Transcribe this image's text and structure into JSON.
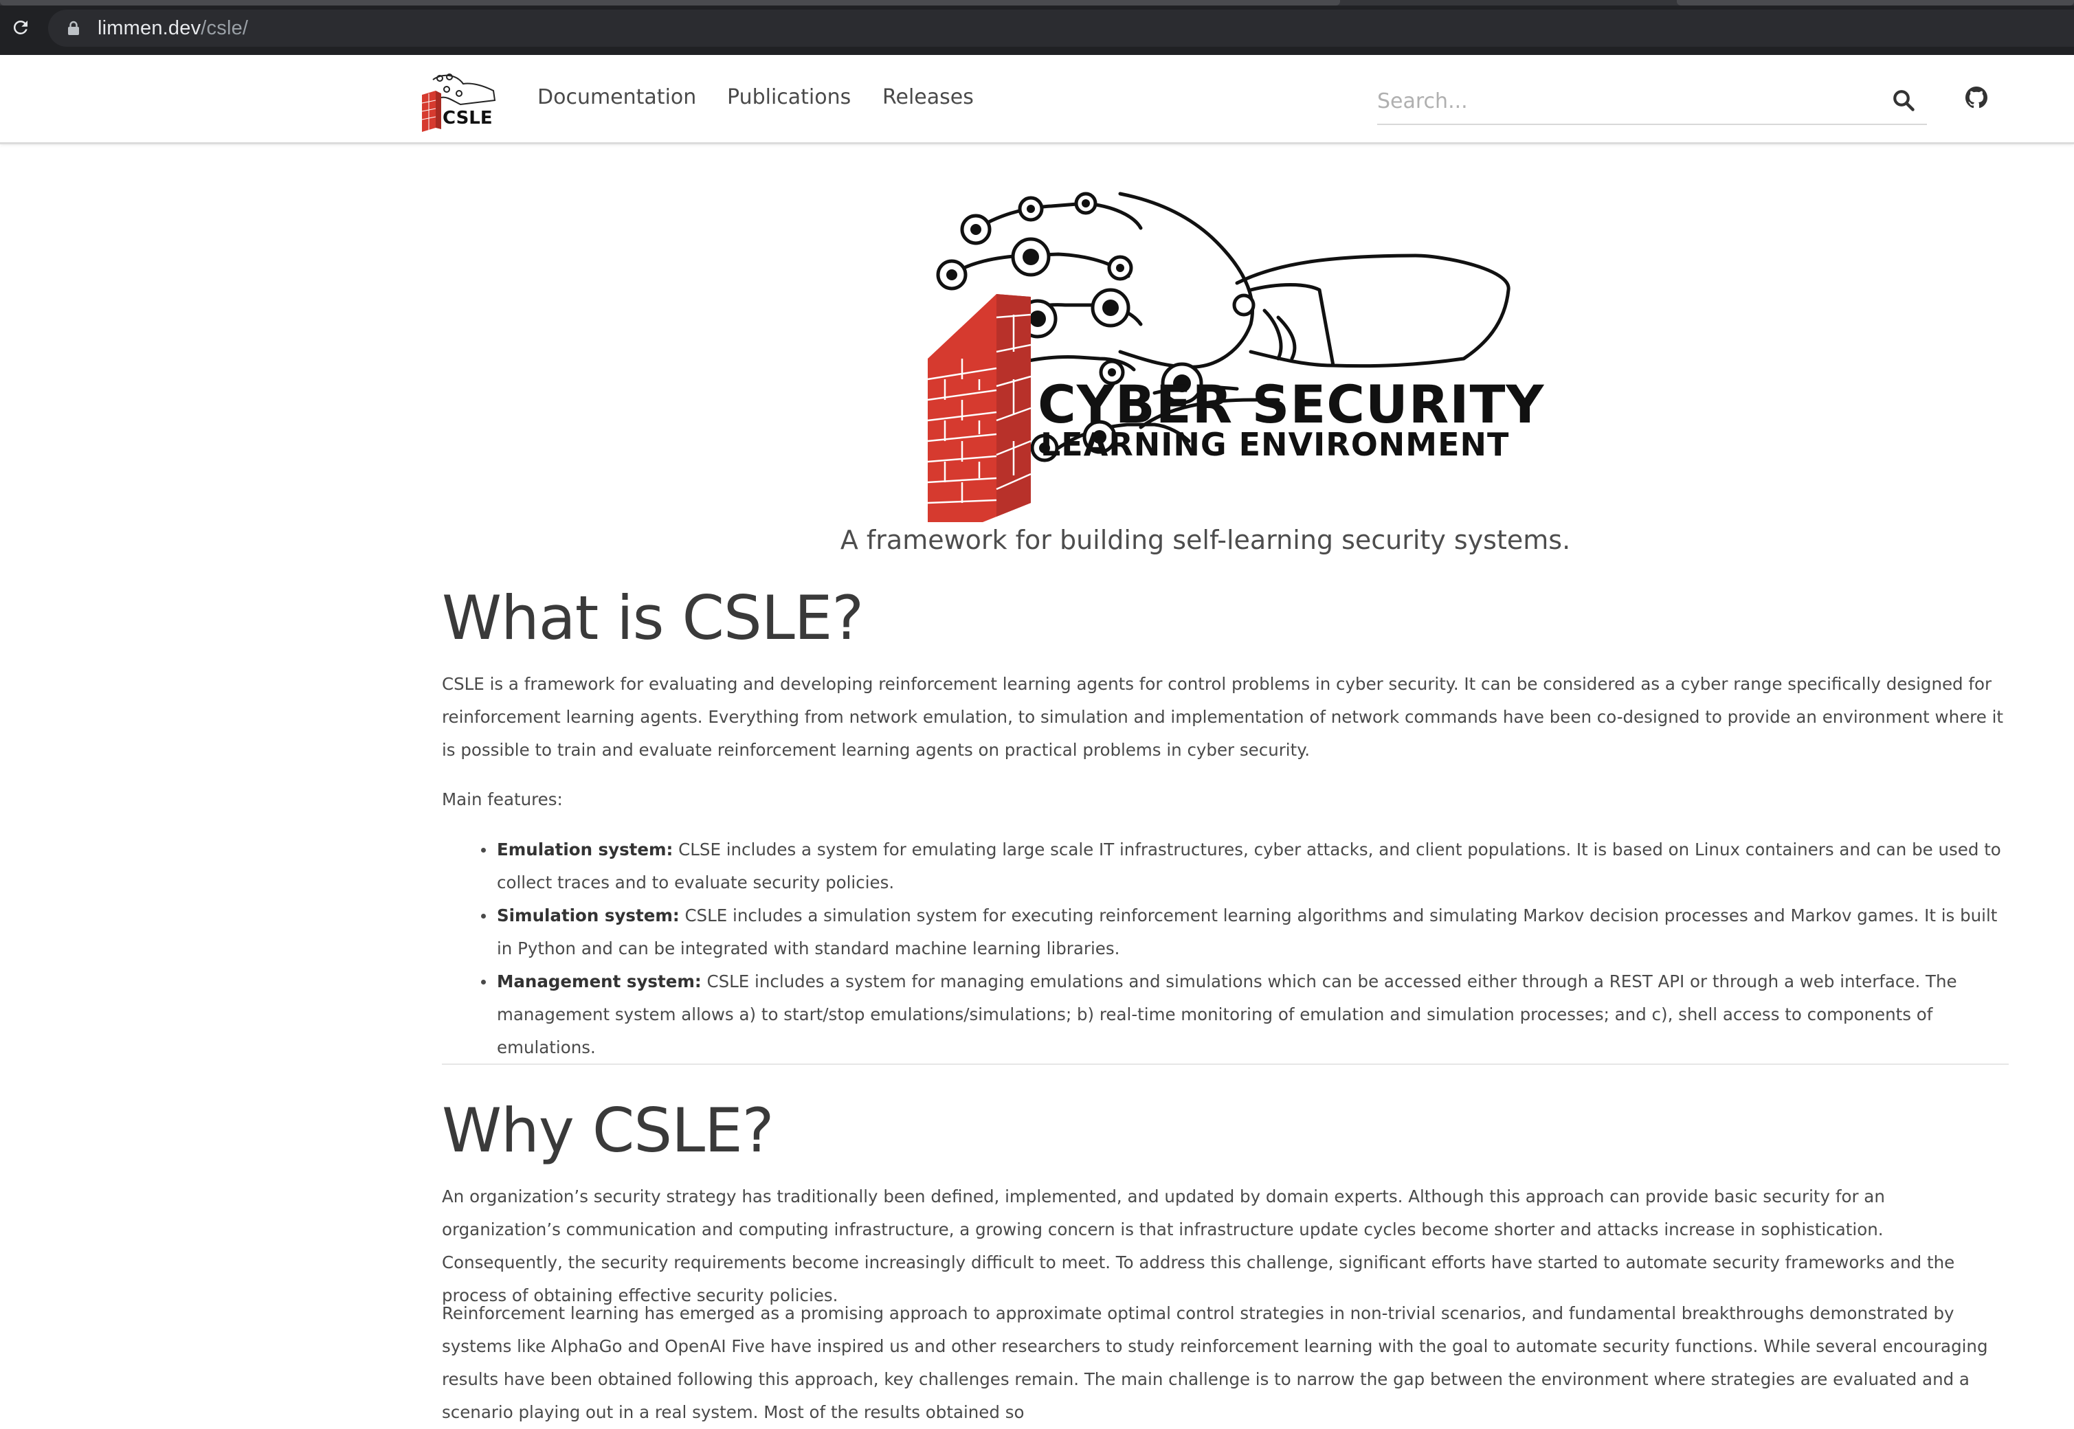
{
  "browser": {
    "url_host": "limmen.dev",
    "url_path": "/csle/"
  },
  "header": {
    "logo_text": "CSLE",
    "nav": [
      {
        "label": "Documentation"
      },
      {
        "label": "Publications"
      },
      {
        "label": "Releases"
      }
    ],
    "search": {
      "placeholder": "Search...",
      "value": ""
    },
    "icons": {
      "search": "search-icon",
      "github": "github-icon"
    }
  },
  "hero": {
    "title_line1": "CYBER SECURITY",
    "title_line2": "LEARNING ENVIRONMENT",
    "tagline": "A framework for building self-learning security systems."
  },
  "sections": {
    "what": {
      "title": "What is CSLE?",
      "intro": "CSLE is a framework for evaluating and developing reinforcement learning agents for control problems in cyber security. It can be considered as a cyber range specifically designed for reinforcement learning agents. Everything from network emulation, to simulation and implementation of network commands have been co-designed to provide an environment where it is possible to train and evaluate reinforcement learning agents on practical problems in cyber security.",
      "features_label": "Main features:",
      "features": [
        {
          "name": "Emulation system:",
          "text": " CLSE includes a system for emulating large scale IT infrastructures, cyber attacks, and client populations. It is based on Linux containers and can be used to collect traces and to evaluate security policies."
        },
        {
          "name": "Simulation system:",
          "text": " CSLE includes a simulation system for executing reinforcement learning algorithms and simulating Markov decision processes and Markov games. It is built in Python and can be integrated with standard machine learning libraries."
        },
        {
          "name": "Management system:",
          "text": " CSLE includes a system for managing emulations and simulations which can be accessed either through a REST API or through a web interface. The management system allows a) to start/stop emulations/simulations; b) real-time monitoring of emulation and simulation processes; and c), shell access to components of emulations."
        }
      ]
    },
    "why": {
      "title": "Why CSLE?",
      "p1": "An organization’s security strategy has traditionally been defined, implemented, and updated by domain experts. Although this approach can provide basic security for an organization’s communication and computing infrastructure, a growing concern is that infrastructure update cycles become shorter and attacks increase in sophistication. Consequently, the security requirements become increasingly difficult to meet. To address this challenge, significant efforts have started to automate security frameworks and the process of obtaining effective security policies.",
      "p2": "Reinforcement learning has emerged as a promising approach to approximate optimal control strategies in non-trivial scenarios, and fundamental breakthroughs demonstrated by systems like AlphaGo and OpenAI Five have inspired us and other researchers to study reinforcement learning with the goal to automate security functions. While several encouraging results have been obtained following this approach, key challenges remain. The main challenge is to narrow the gap between the environment where strategies are evaluated and a scenario playing out in a real system. Most of the results obtained so"
    }
  },
  "colors": {
    "chrome_bg": "#202124",
    "brick_red": "#d63a2f",
    "text": "#4a4a4a",
    "heading": "#3a3a3a"
  }
}
